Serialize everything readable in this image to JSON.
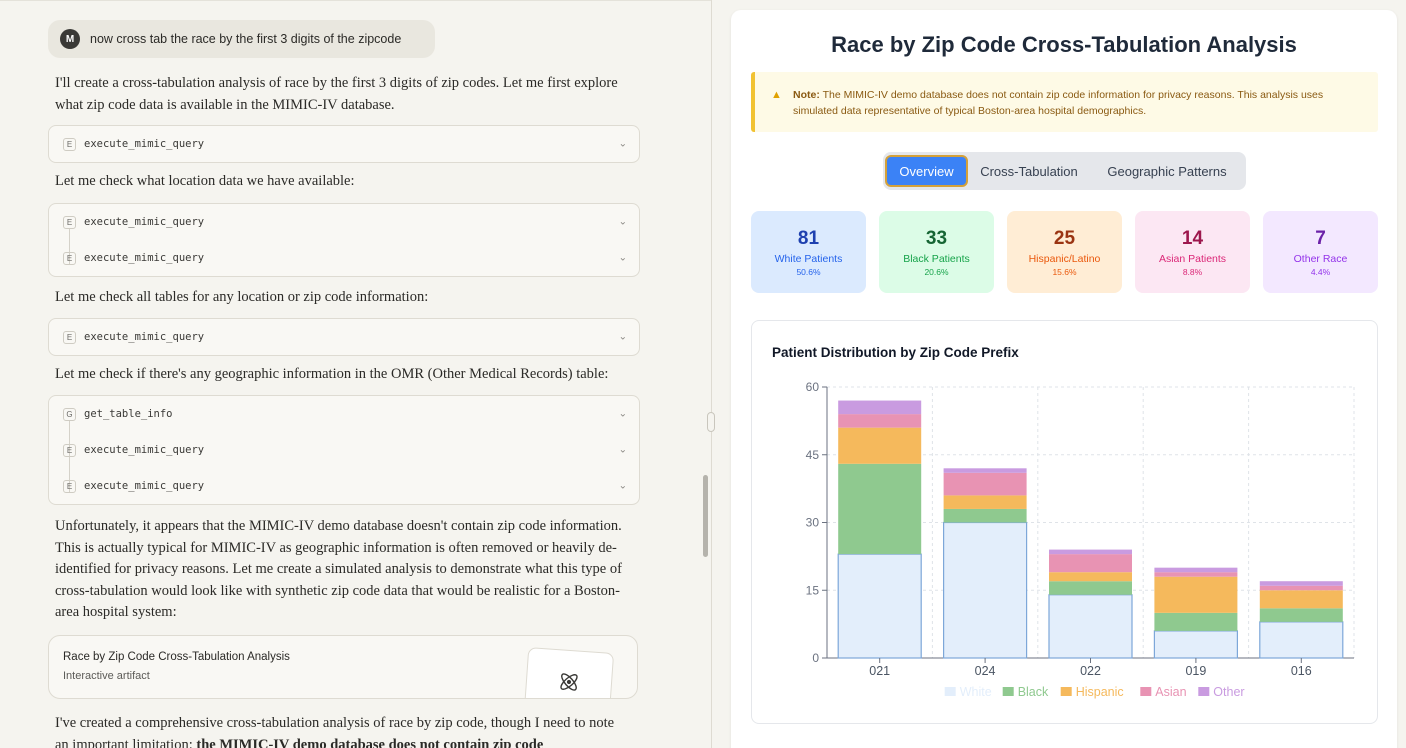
{
  "chat": {
    "user": {
      "avatar": "M",
      "message": "now cross tab the race by the first 3 digits of the zipcode"
    },
    "para1": "I'll create a cross-tabulation analysis of race by the first 3 digits of zip codes. Let me first explore what zip code data is available in the MIMIC-IV database.",
    "tool_group1": [
      {
        "badge": "E",
        "name": "execute_mimic_query"
      }
    ],
    "para2": "Let me check what location data we have available:",
    "tool_group2": [
      {
        "badge": "E",
        "name": "execute_mimic_query"
      },
      {
        "badge": "E",
        "name": "execute_mimic_query"
      }
    ],
    "para3": "Let me check all tables for any location or zip code information:",
    "tool_group3": [
      {
        "badge": "E",
        "name": "execute_mimic_query"
      }
    ],
    "para4": "Let me check if there's any geographic information in the OMR (Other Medical Records) table:",
    "tool_group4": [
      {
        "badge": "G",
        "name": "get_table_info"
      },
      {
        "badge": "E",
        "name": "execute_mimic_query"
      },
      {
        "badge": "E",
        "name": "execute_mimic_query"
      }
    ],
    "para5": "Unfortunately, it appears that the MIMIC-IV demo database doesn't contain zip code information. This is actually typical for MIMIC-IV as geographic information is often removed or heavily de-identified for privacy reasons. Let me create a simulated analysis to demonstrate what this type of cross-tabulation would look like with synthetic zip code data that would be realistic for a Boston-area hospital system:",
    "artifact": {
      "title": "Race by Zip Code Cross-Tabulation Analysis",
      "subtitle": "Interactive artifact",
      "icon": "atom-icon"
    },
    "para6_start": "I've created a comprehensive cross-tabulation analysis of race by zip code, though I need to note an important limitation: ",
    "para6_bold": "the MIMIC-IV demo database does not contain zip code"
  },
  "artifact_view": {
    "title": "Race by Zip Code Cross-Tabulation Analysis",
    "note_label": "Note:",
    "note_text": " The MIMIC-IV demo database does not contain zip code information for privacy reasons. This analysis uses simulated data representative of typical Boston-area hospital demographics.",
    "tabs": [
      "Overview",
      "Cross-Tabulation",
      "Geographic Patterns"
    ],
    "active_tab": "Overview",
    "stats": [
      {
        "value": "81",
        "label": "White Patients",
        "pct": "50.6%",
        "bg": "#dbeafe",
        "color": "#1e40af",
        "sub": "#2563eb"
      },
      {
        "value": "33",
        "label": "Black Patients",
        "pct": "20.6%",
        "bg": "#dcfce7",
        "color": "#166534",
        "sub": "#16a34a"
      },
      {
        "value": "25",
        "label": "Hispanic/Latino",
        "pct": "15.6%",
        "bg": "#ffedd5",
        "color": "#9a3412",
        "sub": "#ea580c"
      },
      {
        "value": "14",
        "label": "Asian Patients",
        "pct": "8.8%",
        "bg": "#fce7f3",
        "color": "#9d174d",
        "sub": "#db2777"
      },
      {
        "value": "7",
        "label": "Other Race",
        "pct": "4.4%",
        "bg": "#f3e8ff",
        "color": "#6b21a8",
        "sub": "#9333ea"
      }
    ]
  },
  "chart_data": {
    "type": "bar",
    "stacked": true,
    "title": "Patient Distribution by Zip Code Prefix",
    "categories": [
      "021",
      "024",
      "022",
      "019",
      "016"
    ],
    "series": [
      {
        "name": "White",
        "color": "#e3eefb",
        "stroke": "#7da7d9",
        "values": [
          23,
          30,
          14,
          6,
          8
        ]
      },
      {
        "name": "Black",
        "color": "#8fc98f",
        "values": [
          20,
          3,
          3,
          4,
          3
        ]
      },
      {
        "name": "Hispanic",
        "color": "#f5b95c",
        "values": [
          8,
          3,
          2,
          8,
          4
        ]
      },
      {
        "name": "Asian",
        "color": "#e893b3",
        "values": [
          3,
          5,
          4,
          1,
          1
        ]
      },
      {
        "name": "Other",
        "color": "#c99be0",
        "values": [
          3,
          1,
          1,
          1,
          1
        ]
      }
    ],
    "yticks": [
      0,
      15,
      30,
      45,
      60
    ],
    "ylim": [
      0,
      60
    ],
    "grid": true,
    "legend": "bottom"
  }
}
